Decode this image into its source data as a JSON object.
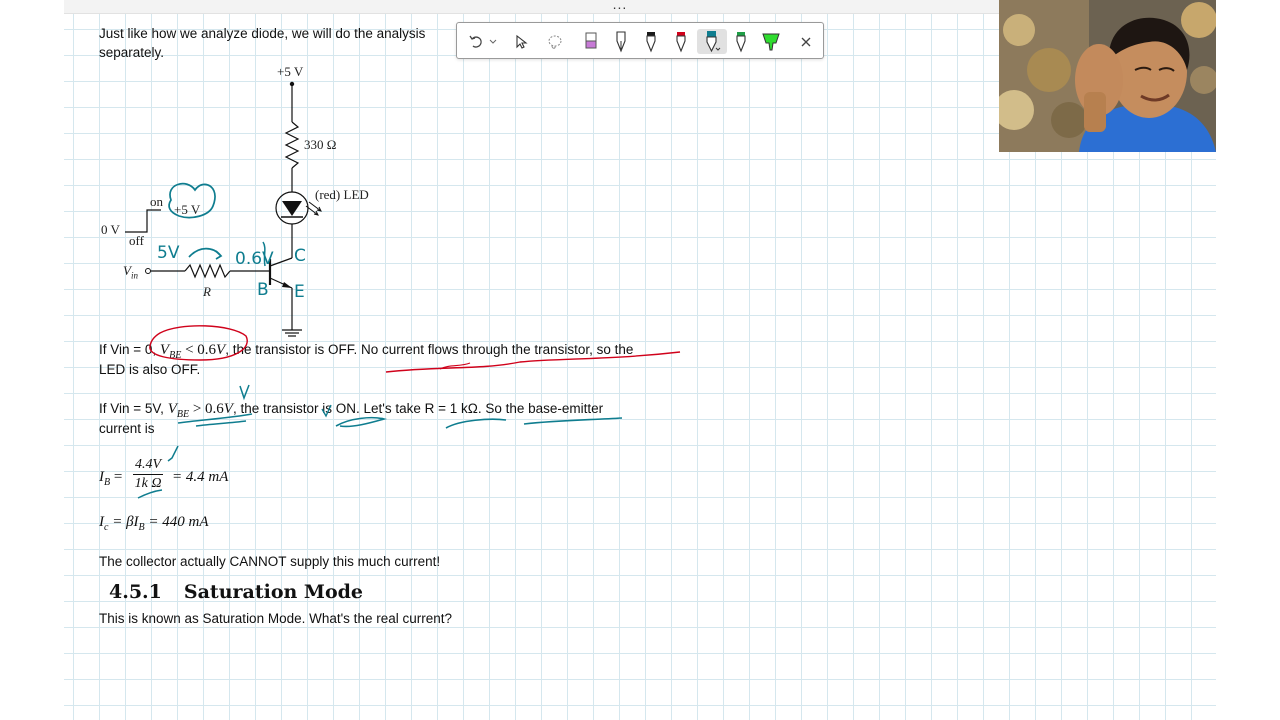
{
  "window": {
    "more_label": "..."
  },
  "toolbar": {
    "tools": [
      "undo",
      "undo-dropdown",
      "select",
      "lasso",
      "pen-purple",
      "pen-outline",
      "pen-black",
      "pen-red",
      "pen-teal",
      "pen-green",
      "highlighter-green",
      "close"
    ],
    "colors": {
      "purple": "#c77ad6",
      "black": "#1a1a1a",
      "red": "#d0021b",
      "teal": "#0f7d8f",
      "green": "#1f9e46",
      "highlighter": "#2fdc2f"
    }
  },
  "document": {
    "intro_line1": "Just like how we analyze diode, we will do the analysis",
    "intro_line2": "separately.",
    "off_prefix": "If Vin = 0, ",
    "off_cond_sym": "V",
    "off_cond_sub": "BE",
    "off_cond_rel": " < 0.6",
    "off_cond_unit": "V",
    "off_suffix": ", the transistor is OFF. No current flows through the transistor, so the",
    "off_line2": "LED is also OFF.",
    "on_prefix": "If Vin = 5V, ",
    "on_cond_sym": "V",
    "on_cond_sub": "BE",
    "on_cond_rel": " >  0.6",
    "on_cond_unit": "V",
    "on_suffix": ", the transistor is ON. Let's take R = 1 kΩ. So the base-emitter",
    "on_line2": "current is",
    "ib_lhs_sym": "I",
    "ib_lhs_sub": "B",
    "ib_eq": " = ",
    "ib_num": "4.4V",
    "ib_den": "1k Ω",
    "ib_rhs": "= 4.4 mA",
    "ic_sym": "I",
    "ic_sub": "c",
    "ic_mid": " = βI",
    "ic_mid_sub": "B",
    "ic_rhs": " = 440 mA",
    "collector_note": "The collector actually CANNOT supply this much current!",
    "section_number": "4.5.1",
    "section_title": "Saturation Mode",
    "saturation_text": "This is known as Saturation Mode. What's the real current?"
  },
  "diagram": {
    "supply": "+5 V",
    "resistor": "330 Ω",
    "led": "(red) LED",
    "on": "on",
    "off": "off",
    "zero_v": "0 V",
    "vin": "V",
    "vin_sub": "in",
    "r": "R",
    "plus5_handwritten": "+5 V",
    "hw_5v": "5V",
    "hw_06v": "0.6V",
    "hw_c": "C",
    "hw_b": "B",
    "hw_e": "E"
  },
  "ink_color": "#0f7d8f",
  "red_ink": "#d0021b"
}
